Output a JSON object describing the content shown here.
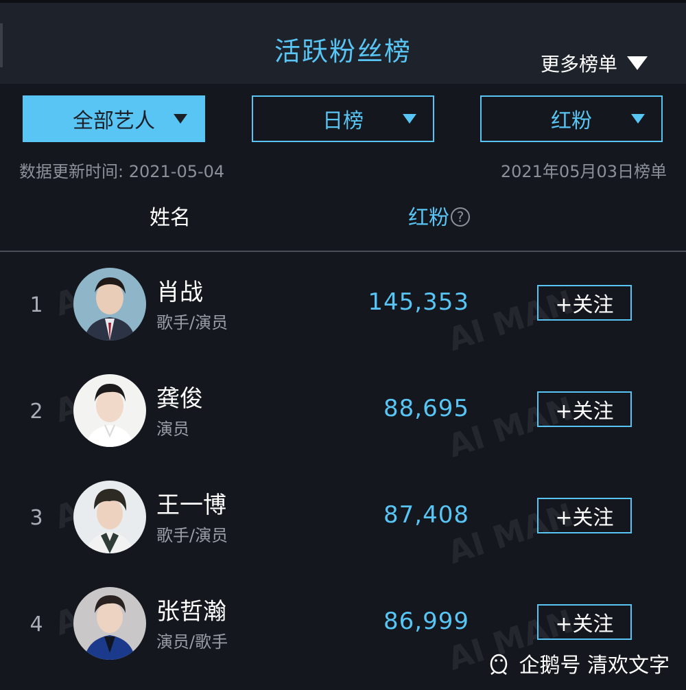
{
  "header": {
    "title": "活跃粉丝榜",
    "more_label": "更多榜单"
  },
  "filters": [
    {
      "label": "全部艺人",
      "active": true
    },
    {
      "label": "日榜",
      "active": false
    },
    {
      "label": "红粉",
      "active": false
    }
  ],
  "meta": {
    "updated": "数据更新时间: 2021-05-04",
    "list_date": "2021年05月03日榜单"
  },
  "columns": {
    "name": "姓名",
    "fans": "红粉"
  },
  "rows": [
    {
      "rank": "1",
      "name": "肖战",
      "role": "歌手/演员",
      "fans": "145,353",
      "follow": "+关注"
    },
    {
      "rank": "2",
      "name": "龚俊",
      "role": "演员",
      "fans": "88,695",
      "follow": "+关注"
    },
    {
      "rank": "3",
      "name": "王一博",
      "role": "歌手/演员",
      "fans": "87,408",
      "follow": "+关注"
    },
    {
      "rank": "4",
      "name": "张哲瀚",
      "role": "演员/歌手",
      "fans": "86,999",
      "follow": "+关注"
    }
  ],
  "footer": {
    "credit": "企鹅号 清欢文字"
  },
  "colors": {
    "accent": "#59c5f4",
    "background": "#14171e",
    "header": "#1d222b"
  }
}
